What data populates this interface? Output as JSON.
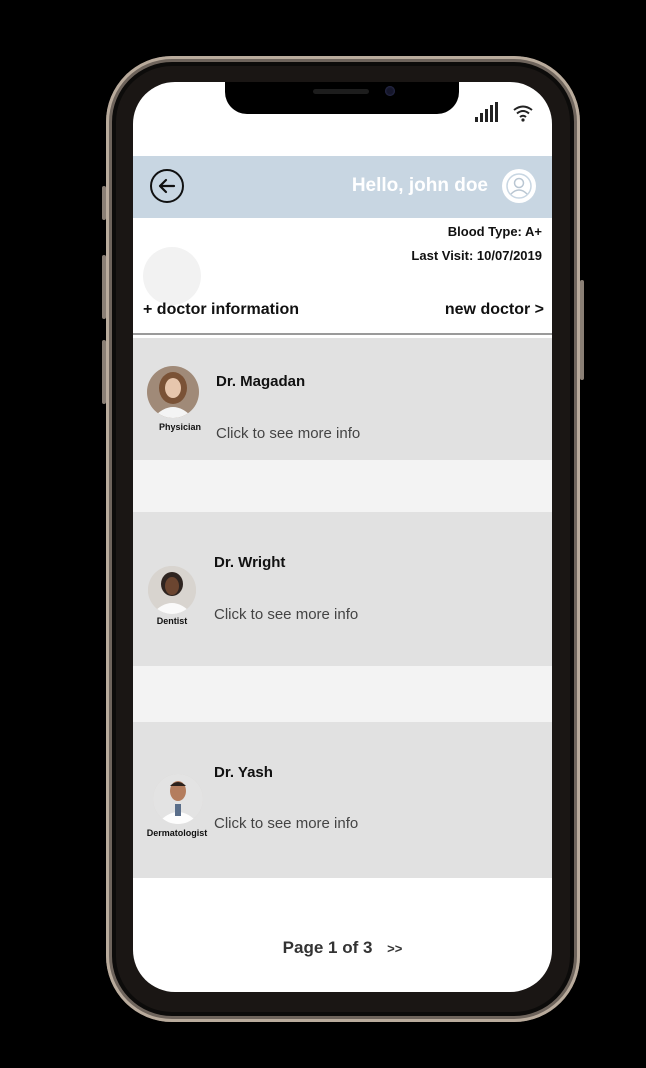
{
  "header": {
    "greeting": "Hello, john doe"
  },
  "patient": {
    "blood_type": "Blood Type:  A+",
    "last_visit": "Last Visit: 10/07/2019"
  },
  "section": {
    "title": "+ doctor information",
    "new_doctor": "new doctor >"
  },
  "doctors": [
    {
      "name": "Dr. Magadan",
      "role": "Physician",
      "link": "Click to see more info"
    },
    {
      "name": "Dr. Wright",
      "role": "Dentist",
      "link": "Click to see more info"
    },
    {
      "name": "Dr. Yash",
      "role": "Dermatologist",
      "link": "Click to see more info"
    }
  ],
  "pagination": {
    "label": "Page 1 of 3",
    "next": ">>"
  },
  "colors": {
    "header_bg": "#c8d6e2",
    "card_bg": "#e1e1e1"
  },
  "icons": [
    "signal-icon",
    "wifi-icon",
    "back-arrow-icon",
    "user-avatar-icon"
  ]
}
